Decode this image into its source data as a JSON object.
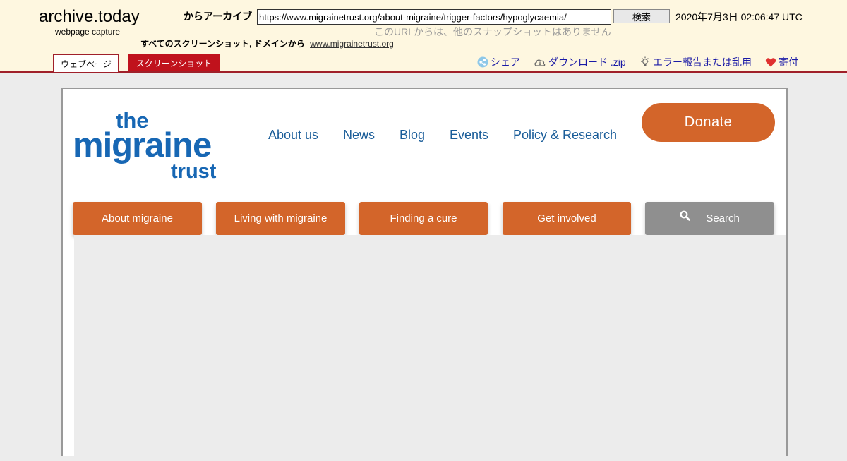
{
  "archive": {
    "site_name": "archive.today",
    "subtitle": "webpage capture",
    "archive_label": "からアーカイブ",
    "url_value": "https://www.migrainetrust.org/about-migraine/trigger-factors/hypoglycaemia/",
    "search_label": "検索",
    "date": "2020年7月3日 02:06:47 UTC",
    "no_other_snapshots": "このURLからは、他のスナップショットはありません",
    "all_screenshots_label": "すべてのスクリーンショット, ドメインから",
    "domain_link": "www.migrainetrust.org",
    "tabs": {
      "webpage": "ウェブページ",
      "screenshot": "スクリーンショット"
    },
    "actions": {
      "share": "シェア",
      "download": "ダウンロード .zip",
      "report": "エラー報告または乱用",
      "donate": "寄付"
    }
  },
  "site": {
    "logo": {
      "line1": "the",
      "line2": "migraine",
      "line3": "trust"
    },
    "nav": [
      "About us",
      "News",
      "Blog",
      "Events",
      "Policy & Research"
    ],
    "donate_label": "Donate",
    "menu": [
      "About migraine",
      "Living with migraine",
      "Finding a cure",
      "Get involved"
    ],
    "search_label": "Search"
  },
  "colors": {
    "archive_bg": "#fef7e0",
    "archive_red": "#c0121c",
    "brand_blue": "#1767b4",
    "nav_blue": "#1a5d99",
    "brand_orange": "#d3652a",
    "search_gray": "#8f8f8f"
  }
}
